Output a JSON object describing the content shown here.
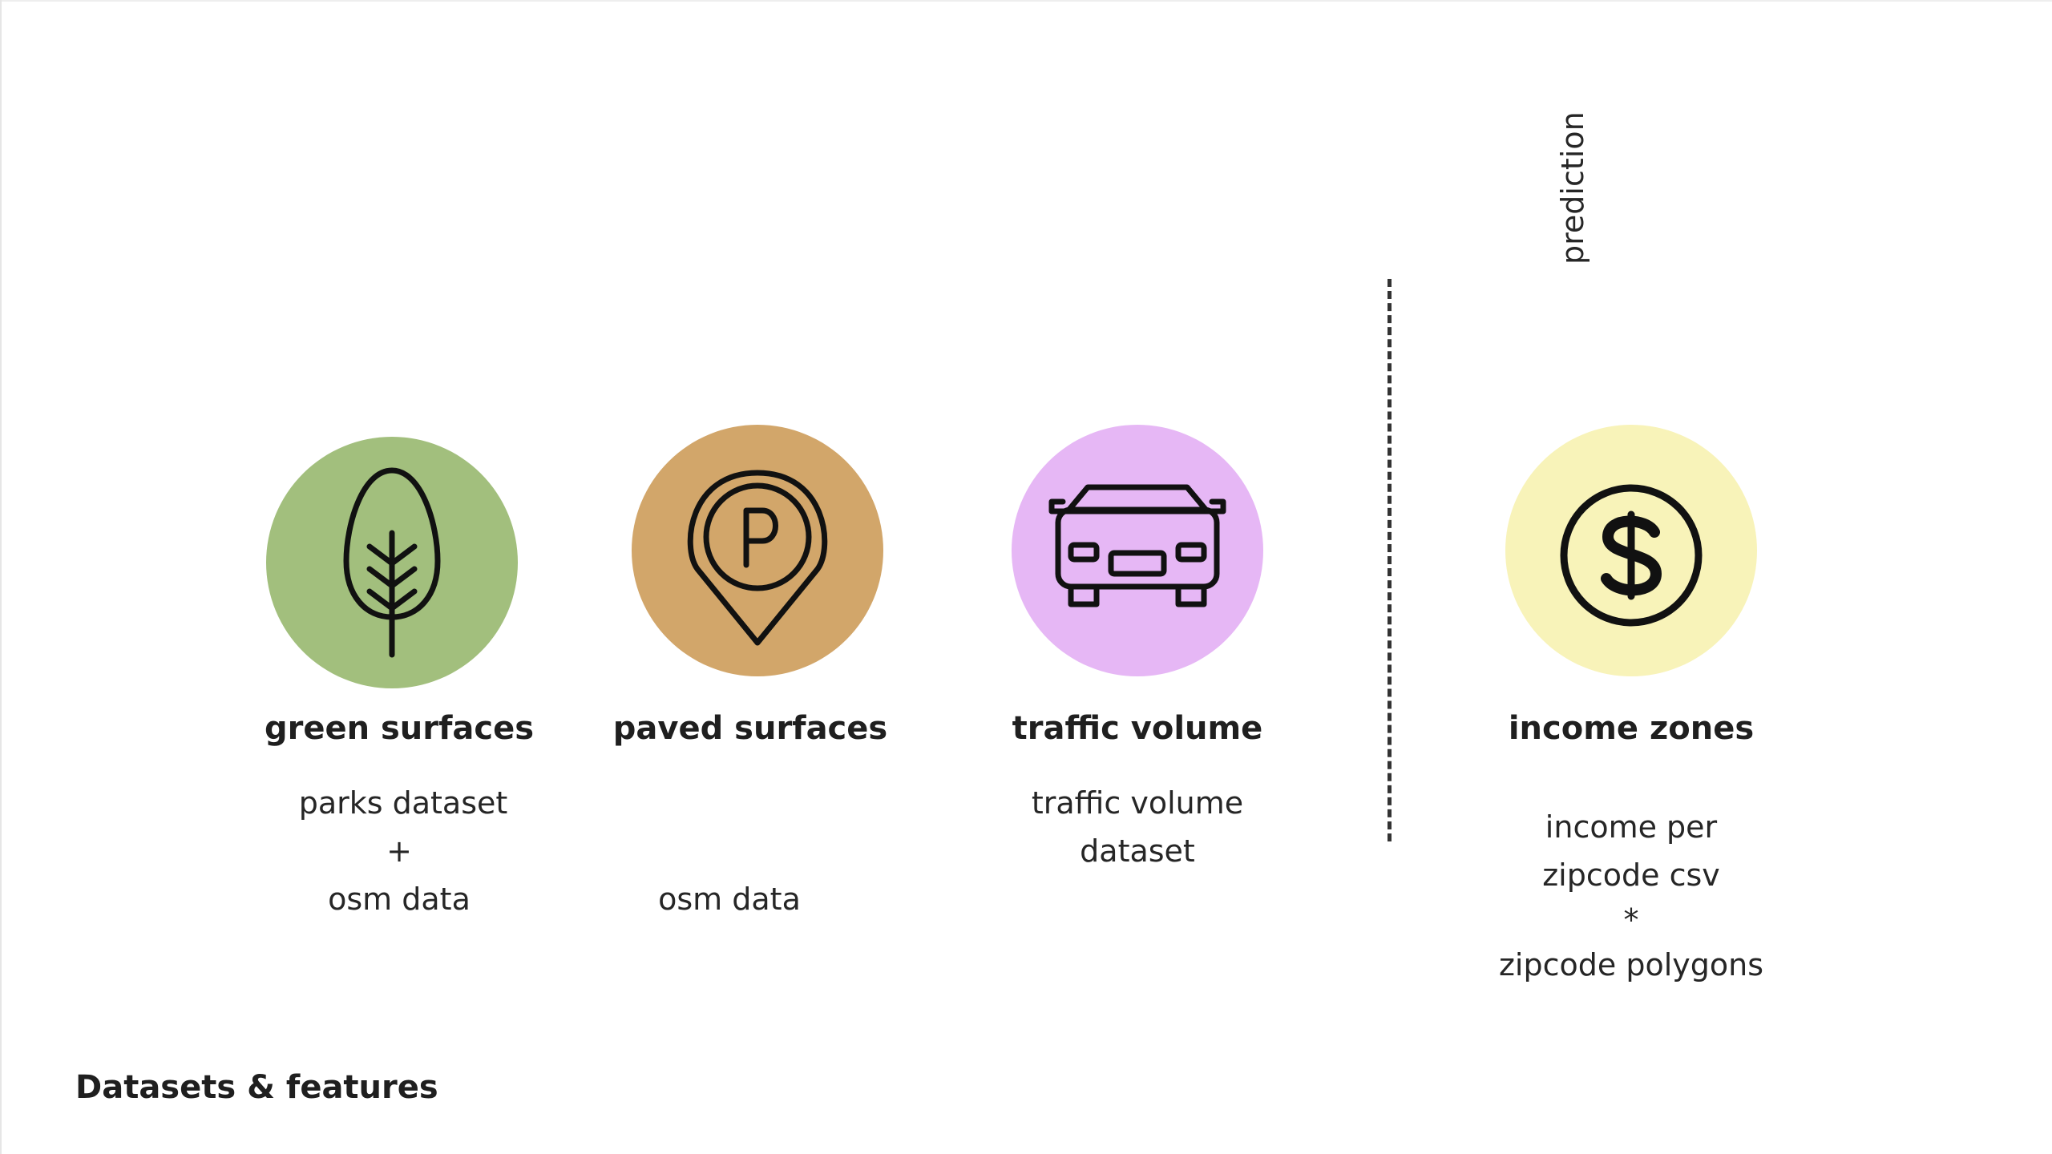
{
  "colors": {
    "green": "#a2bf7d",
    "tan": "#d2a66a",
    "pink": "#e6b7f5",
    "yellow": "#f8f3b9",
    "stroke": "#111111"
  },
  "features": [
    {
      "title": "green surfaces",
      "icon": "tree-icon",
      "desc": [
        "parks dataset",
        "+",
        "osm data"
      ]
    },
    {
      "title": "paved surfaces",
      "icon": "parking-pin-icon",
      "desc": [
        "osm data"
      ]
    },
    {
      "title": "traffic volume",
      "icon": "car-icon",
      "desc": [
        "traffic volume",
        "dataset"
      ]
    },
    {
      "title": "income zones",
      "icon": "dollar-coin-icon",
      "desc": [
        "income per",
        "zipcode csv",
        "*",
        "zipcode polygons"
      ]
    }
  ],
  "prediction_label": "prediction",
  "footer_title": "Datasets & features"
}
